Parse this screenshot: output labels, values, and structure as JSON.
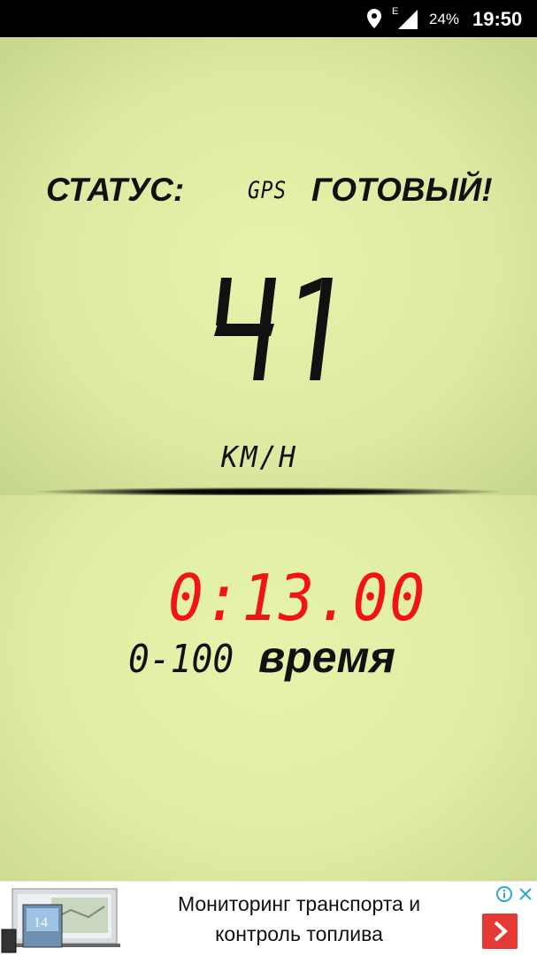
{
  "status_bar": {
    "network_type": "E",
    "battery": "24%",
    "time": "19:50",
    "icons": [
      "location-icon",
      "signal-icon"
    ]
  },
  "main": {
    "status_label": "СТАТУС:",
    "gps_label": "GPS",
    "ready_label": "ГОТОВЫЙ!",
    "speed": "41",
    "unit": "KM/H",
    "timer": "0:13.00",
    "range": "0-100",
    "time_word": "время"
  },
  "ad": {
    "image_text": "14",
    "line1": "Мониторинг транспорта и",
    "line2": "контроль топлива",
    "icons": [
      "info-icon",
      "close-icon",
      "arrow-right-icon"
    ]
  },
  "colors": {
    "background": "#e3f1ab",
    "timer": "#f21313",
    "text": "#111111",
    "ad_button": "#e53935"
  }
}
